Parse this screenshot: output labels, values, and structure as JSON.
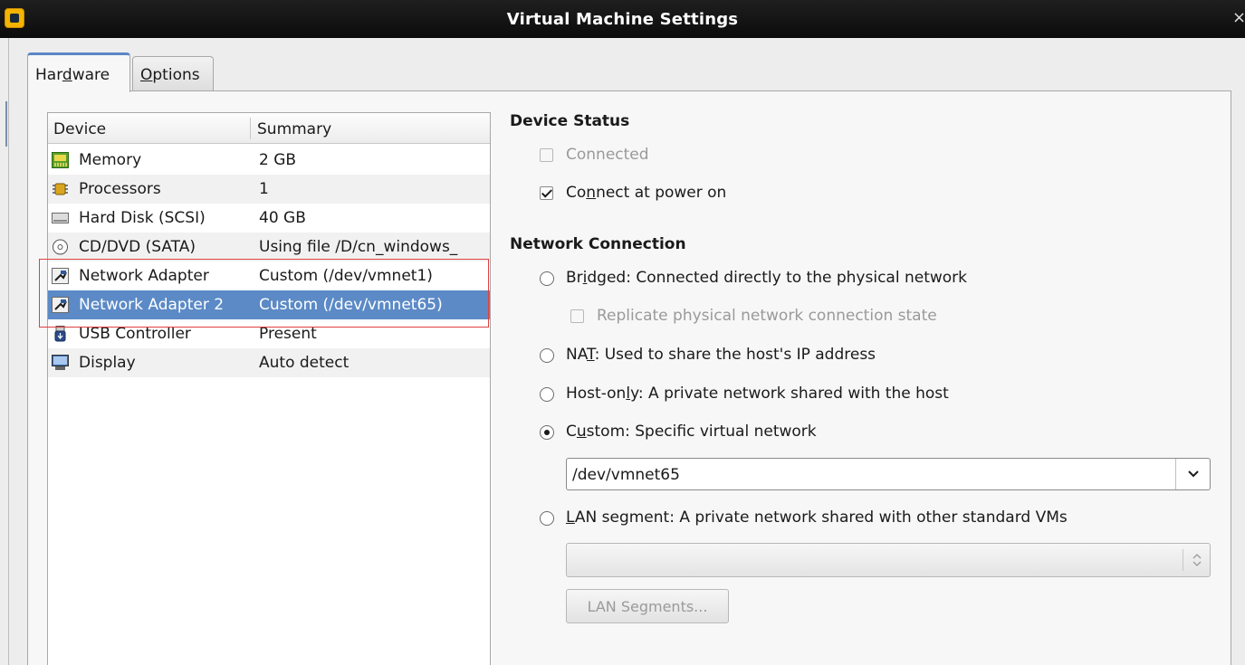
{
  "window": {
    "title": "Virtual Machine Settings",
    "close_glyph": "×"
  },
  "tabs": [
    {
      "pre": "Har",
      "key": "d",
      "post": "ware",
      "label": "Hardware",
      "active": true
    },
    {
      "pre": "",
      "key": "O",
      "post": "ptions",
      "label": "Options",
      "active": false
    }
  ],
  "device_list": {
    "columns": [
      "Device",
      "Summary"
    ],
    "rows": [
      {
        "device": "Memory",
        "summary": "2 GB",
        "icon": "memory-icon"
      },
      {
        "device": "Processors",
        "summary": "1",
        "icon": "processor-icon"
      },
      {
        "device": "Hard Disk (SCSI)",
        "summary": "40 GB",
        "icon": "hard-disk-icon"
      },
      {
        "device": "CD/DVD (SATA)",
        "summary": "Using file /D/cn_windows_",
        "icon": "cd-dvd-icon"
      },
      {
        "device": "Network Adapter",
        "summary": "Custom (/dev/vmnet1)",
        "icon": "network-adapter-icon"
      },
      {
        "device": "Network Adapter 2",
        "summary": "Custom (/dev/vmnet65)",
        "icon": "network-adapter-icon",
        "selected": true
      },
      {
        "device": "USB Controller",
        "summary": "Present",
        "icon": "usb-icon"
      },
      {
        "device": "Display",
        "summary": "Auto detect",
        "icon": "display-icon"
      }
    ]
  },
  "device_status": {
    "title": "Device Status",
    "connected": {
      "label": "Connected",
      "checked": false,
      "enabled": false
    },
    "connect_at_power_on": {
      "pre": "Co",
      "key": "n",
      "post": "nect at power on",
      "label": "Connect at power on",
      "checked": true
    }
  },
  "network_connection": {
    "title": "Network Connection",
    "bridged": {
      "pre": "Br",
      "key": "i",
      "post": "dged: Connected directly to the physical network",
      "label": "Bridged: Connected directly to the physical network",
      "selected": false
    },
    "replicate": {
      "label": "Replicate physical network connection state",
      "checked": false,
      "enabled": false
    },
    "nat": {
      "pre": "NA",
      "key": "T",
      "post": ": Used to share the host's IP address",
      "label": "NAT: Used to share the host's IP address",
      "selected": false
    },
    "host_only": {
      "pre": "Host-on",
      "key": "l",
      "post": "y: A private network shared with the host",
      "label": "Host-only: A private network shared with the host",
      "selected": false
    },
    "custom": {
      "pre": "C",
      "key": "u",
      "post": "stom: Specific virtual network",
      "label": "Custom: Specific virtual network",
      "selected": true
    },
    "custom_network_value": "/dev/vmnet65",
    "lan_segment": {
      "pre": "",
      "key": "L",
      "post": "AN segment: A private network shared with other standard VMs",
      "label": "LAN segment: A private network shared with other standard VMs",
      "selected": false
    },
    "lan_segment_value": "",
    "lan_segments_button": "LAN Segments..."
  },
  "colors": {
    "selection": "#5b8ac6",
    "highlight_box": "#e04040",
    "titlebar": "#111111"
  }
}
